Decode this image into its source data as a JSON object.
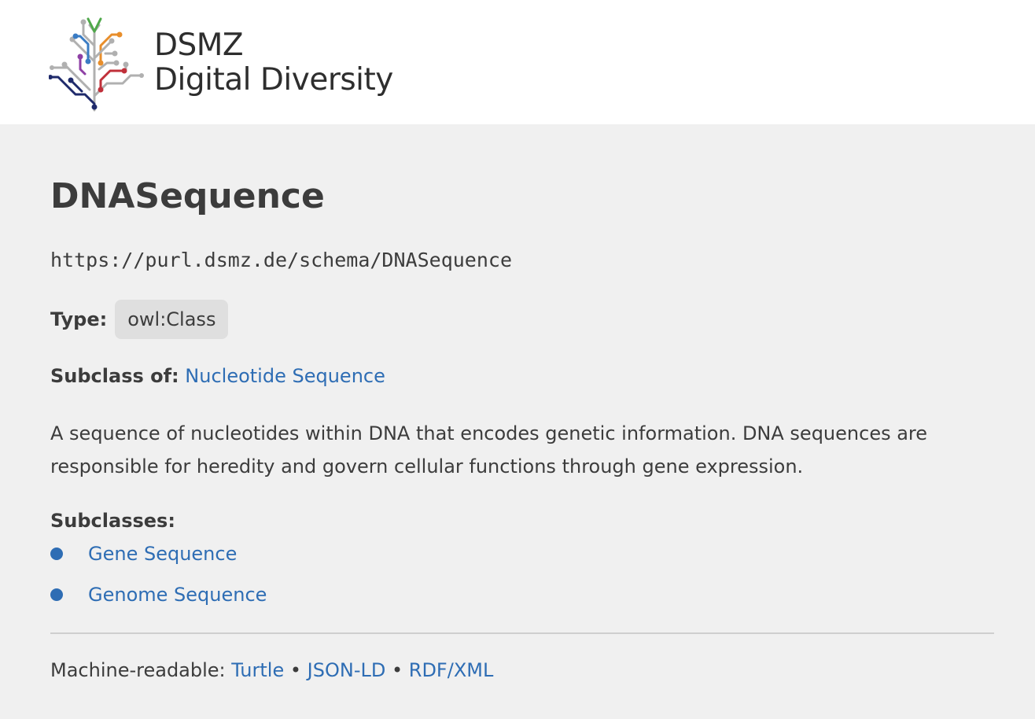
{
  "header": {
    "logo_line1": "DSMZ",
    "logo_line2": "Digital Diversity",
    "logo_icon": "tree-circuit-logo-icon"
  },
  "main": {
    "title": "DNASequence",
    "iri": "https://purl.dsmz.de/schema/DNASequence",
    "type_label": "Type:",
    "type_value": "owl:Class",
    "subclass_of_label": "Subclass of:",
    "subclass_of_value": "Nucleotide Sequence",
    "description": "A sequence of nucleotides within DNA that encodes genetic information. DNA sequences are responsible for heredity and govern cellular functions through gene expression.",
    "subclasses_label": "Subclasses:",
    "subclasses": [
      {
        "label": "Gene Sequence"
      },
      {
        "label": "Genome Sequence"
      }
    ]
  },
  "footer": {
    "machine_readable_label": "Machine-readable:",
    "separator": "•",
    "formats": [
      {
        "label": "Turtle"
      },
      {
        "label": "JSON-LD"
      },
      {
        "label": "RDF/XML"
      }
    ]
  },
  "colors": {
    "link": "#2e6db4",
    "text": "#3c3c3c",
    "background": "#f0f0f0",
    "header_background": "#ffffff",
    "badge_background": "#dfdfdf"
  }
}
